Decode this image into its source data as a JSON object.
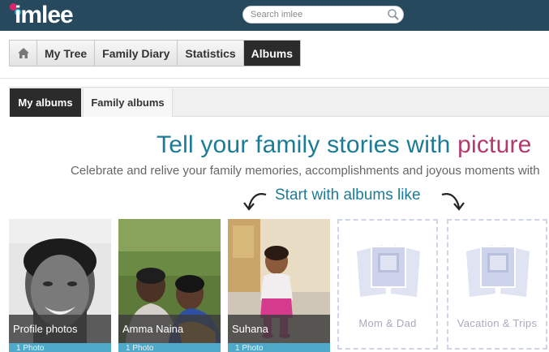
{
  "header": {
    "logo_text": "imlee",
    "search": {
      "placeholder": "Search imlee",
      "icon": "search-icon"
    }
  },
  "nav": {
    "home_icon": "home-icon",
    "items": [
      {
        "label": "My Tree"
      },
      {
        "label": "Family Diary"
      },
      {
        "label": "Statistics"
      },
      {
        "label": "Albums",
        "active": true
      }
    ]
  },
  "subtabs": [
    {
      "label": "My albums",
      "active": true
    },
    {
      "label": "Family albums"
    }
  ],
  "hero": {
    "title_main": "Tell your family stories with ",
    "title_accent": "picture",
    "subtitle": "Celebrate and relive your family memories, accomplishments and joyous moments with",
    "prompt": "Start with albums like"
  },
  "albums": [
    {
      "title": "Profile photos",
      "count": "1 Photo"
    },
    {
      "title": "Amma Naina",
      "count": "1 Photo"
    },
    {
      "title": "Suhana",
      "count": "1 Photo"
    }
  ],
  "suggestions": [
    {
      "title": "Mom & Dad"
    },
    {
      "title": "Vacation & Trips"
    }
  ],
  "colors": {
    "header_bg": "#26495e",
    "accent_teal": "#1c7b96",
    "accent_pink": "#b23a6c",
    "count_bar": "#4fa9c9"
  }
}
